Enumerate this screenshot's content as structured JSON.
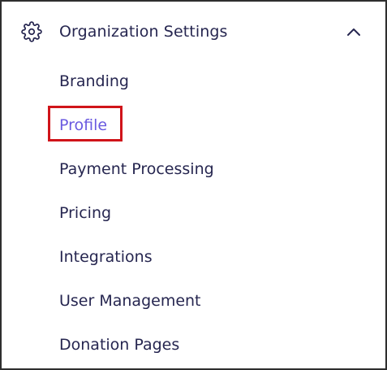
{
  "section": {
    "icon": "gear-icon",
    "title": "Organization Settings",
    "toggle_icon": "chevron-up-icon",
    "expanded": true
  },
  "menu": {
    "items": [
      {
        "label": "Branding",
        "active": false
      },
      {
        "label": "Profile",
        "active": true
      },
      {
        "label": "Payment Processing",
        "active": false
      },
      {
        "label": "Pricing",
        "active": false
      },
      {
        "label": "Integrations",
        "active": false
      },
      {
        "label": "User Management",
        "active": false
      },
      {
        "label": "Donation Pages",
        "active": false
      }
    ]
  },
  "colors": {
    "text": "#262650",
    "active_text": "#6a5ae0",
    "highlight_border": "#d0141a",
    "frame_border": "#2e2e2e"
  }
}
